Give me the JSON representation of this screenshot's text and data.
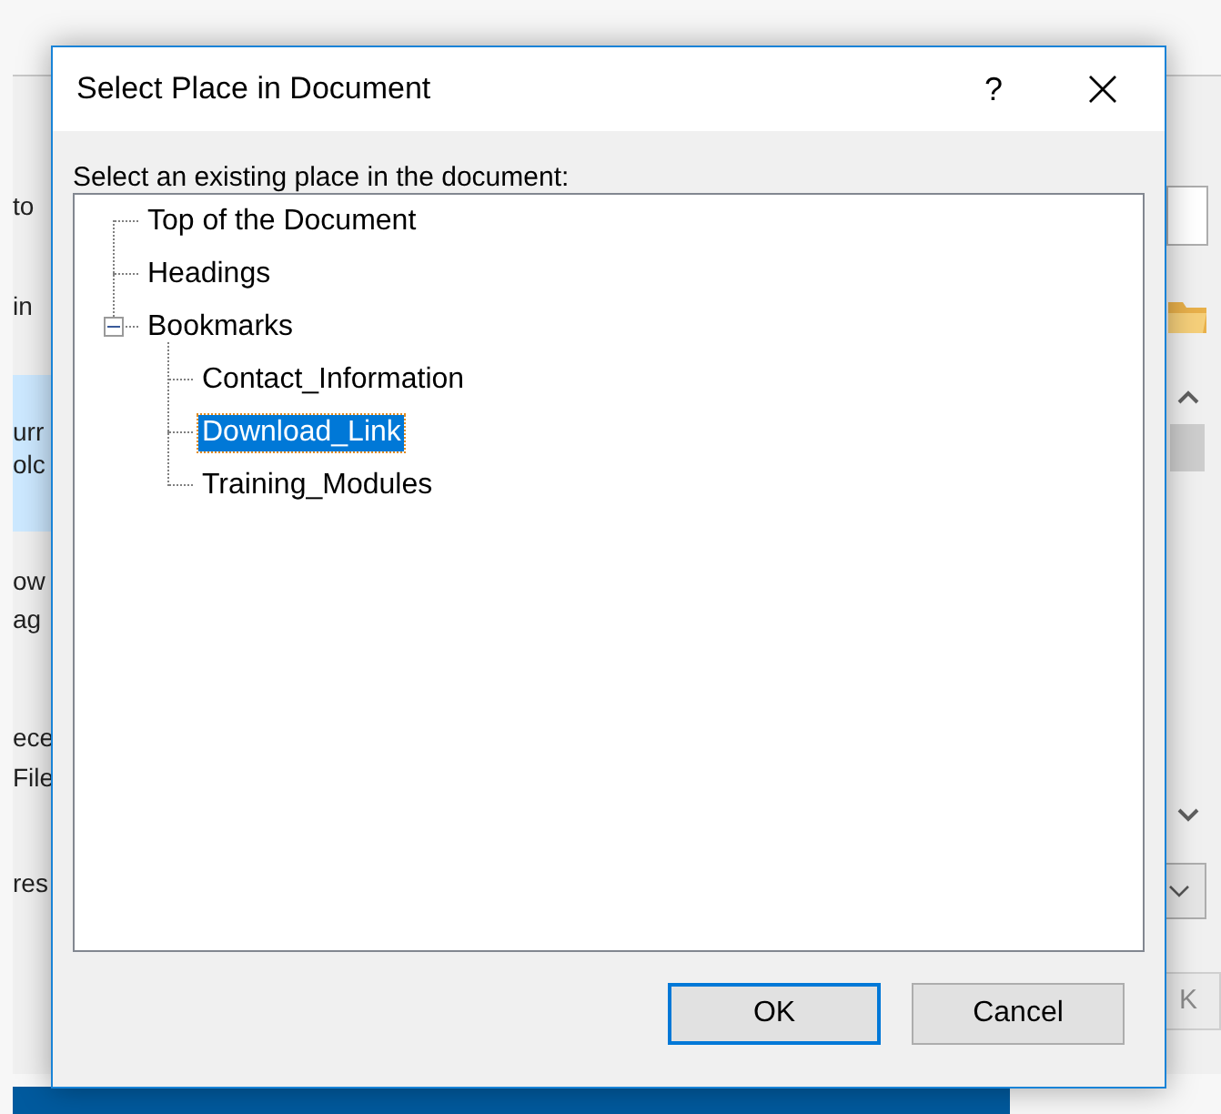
{
  "background_window": {
    "fragments": [
      {
        "text": "to",
        "selected": false
      },
      {
        "text": "in",
        "selected": false
      },
      {
        "text": "urr",
        "selected": true
      },
      {
        "text": "olc",
        "selected": true
      },
      {
        "text": "ow",
        "selected": false
      },
      {
        "text": "ag",
        "selected": false
      },
      {
        "text": "ece",
        "selected": false
      },
      {
        "text": "File",
        "selected": false
      },
      {
        "text": "res",
        "selected": false
      }
    ],
    "ok_button": {
      "label": "K",
      "disabled": true
    }
  },
  "dialog": {
    "title": "Select Place in Document",
    "help": "?",
    "prompt": "Select an existing place in the document:",
    "tree": [
      {
        "label": "Top of the Document",
        "selected": false
      },
      {
        "label": "Headings",
        "selected": false
      },
      {
        "label": "Bookmarks",
        "selected": false,
        "expanded": true,
        "children": [
          {
            "label": "Contact_Information",
            "selected": false
          },
          {
            "label": "Download_Link",
            "selected": true
          },
          {
            "label": "Training_Modules",
            "selected": false
          }
        ]
      }
    ],
    "buttons": [
      {
        "label": "OK",
        "default": true
      },
      {
        "label": "Cancel",
        "default": false
      }
    ]
  }
}
